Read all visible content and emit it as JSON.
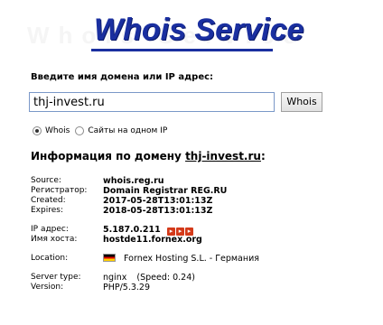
{
  "header": {
    "title": "Whois Service",
    "ghost_text": "Whois Service"
  },
  "form": {
    "prompt": "Введите имя домена или IP адрес:",
    "domain_value": "thj-invest.ru",
    "submit_label": "Whois",
    "radio_whois": "Whois",
    "radio_same_ip": "Сайты на одном IP"
  },
  "info": {
    "title_prefix": "Информация по домену",
    "domain": "thj-invest.ru",
    "colon": ":"
  },
  "details": {
    "source_label": "Source:",
    "source_value": "whois.reg.ru",
    "registrar_label": "Регистратор:",
    "registrar_value": "Domain Registrar REG.RU",
    "created_label": "Created:",
    "created_value": "2017-05-28T13:01:13Z",
    "expires_label": "Expires:",
    "expires_value": "2018-05-28T13:01:13Z",
    "ip_label": "IP адрес:",
    "ip_value": "5.187.0.211",
    "host_label": "Имя хоста:",
    "host_value": "hostde11.fornex.org",
    "location_label": "Location:",
    "location_value": "Fornex Hosting S.L. - Германия",
    "server_type_label": "Server type:",
    "server_type_value": "nginx",
    "speed_text": "(Speed: 0.24)",
    "version_label": "Version:",
    "version_value": "PHP/5.3.29"
  },
  "icons": {
    "arrows": [
      "arrow-right-icon",
      "arrow-right-icon",
      "arrow-right-icon"
    ],
    "flag": "germany-flag-icon"
  },
  "colors": {
    "logo": "#1a2fa0",
    "arrow": "#d43a1a"
  }
}
